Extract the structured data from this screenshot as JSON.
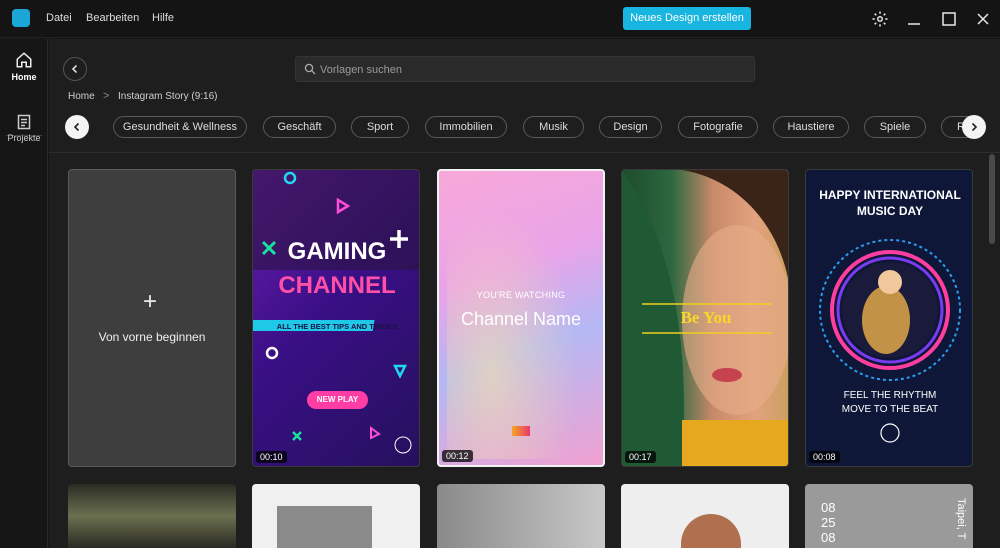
{
  "menu": {
    "file": "Datei",
    "edit": "Bearbeiten",
    "help": "Hilfe"
  },
  "header": {
    "cta_label": "Neues Design erstellen"
  },
  "sidebar": {
    "items": [
      {
        "label": "Home",
        "icon": "home-icon"
      },
      {
        "label": "Projekte",
        "icon": "document-icon"
      }
    ]
  },
  "search": {
    "placeholder": "Vorlagen suchen"
  },
  "breadcrumb": {
    "root": "Home",
    "separator": ">",
    "current": "Instagram Story (9:16)"
  },
  "categories": [
    "Gesundheit & Wellness",
    "Geschäft",
    "Sport",
    "Immobilien",
    "Musik",
    "Design",
    "Fotografie",
    "Haustiere",
    "Spiele",
    "R"
  ],
  "new_card": {
    "label": "Von vorne beginnen",
    "plus": "+"
  },
  "templates": [
    {
      "name": "gaming",
      "duration": "00:10",
      "title1": "GAMING",
      "title2": "CHANNEL",
      "banner": "ALL THE BEST TIPS AND TRICKS",
      "button": "NEW PLAY"
    },
    {
      "name": "channel",
      "duration": "00:12",
      "kicker": "YOU'RE WATCHING",
      "title": "Channel Name"
    },
    {
      "name": "be-you",
      "duration": "00:17",
      "title": "Be You"
    },
    {
      "name": "music-day",
      "duration": "00:08",
      "title": "HAPPY INTERNATIONAL MUSIC DAY",
      "subtitle": "FEEL THE RHYTHM MOVE TO THE BEAT"
    }
  ],
  "row2_texts": {
    "calendar": "08\n25\n08",
    "city": "Taipei, T"
  },
  "colors": {
    "accent": "#17b5e0",
    "bg": "#1e1e1e"
  }
}
